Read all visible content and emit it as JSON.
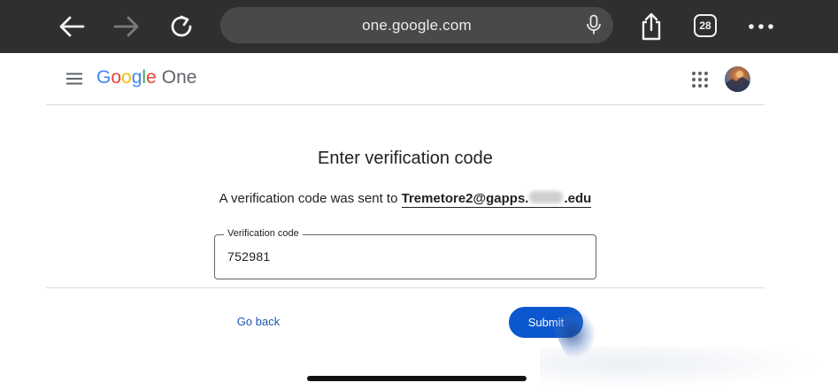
{
  "browser": {
    "url": "one.google.com",
    "tab_count": "28",
    "icons": {
      "back": "back-arrow-icon",
      "forward": "forward-arrow-icon",
      "reload": "reload-icon",
      "mic": "microphone-icon",
      "share": "share-icon",
      "more": "more-horizontal-icon"
    },
    "colors": {
      "bar": "#2f2f31",
      "url_pill": "#49494b"
    }
  },
  "header": {
    "brand": {
      "google": [
        "G",
        "o",
        "o",
        "g",
        "l",
        "e"
      ],
      "google_colors": [
        "#4285F4",
        "#EA4335",
        "#FBBC05",
        "#4285F4",
        "#34A853",
        "#EA4335"
      ],
      "product": "One"
    },
    "icons": {
      "menu": "hamburger-menu-icon",
      "apps": "apps-grid-icon",
      "avatar": "account-avatar"
    }
  },
  "main": {
    "title": "Enter verification code",
    "sent_prefix": "A verification code was sent to",
    "email_start": "Tremetore2@gapps.",
    "email_end": ".edu",
    "code_field": {
      "label": "Verification code",
      "value": "752981"
    },
    "actions": {
      "go_back": "Go back",
      "submit": "Submit"
    },
    "colors": {
      "primary": "#0b57d0",
      "link": "#1a57b0"
    }
  }
}
